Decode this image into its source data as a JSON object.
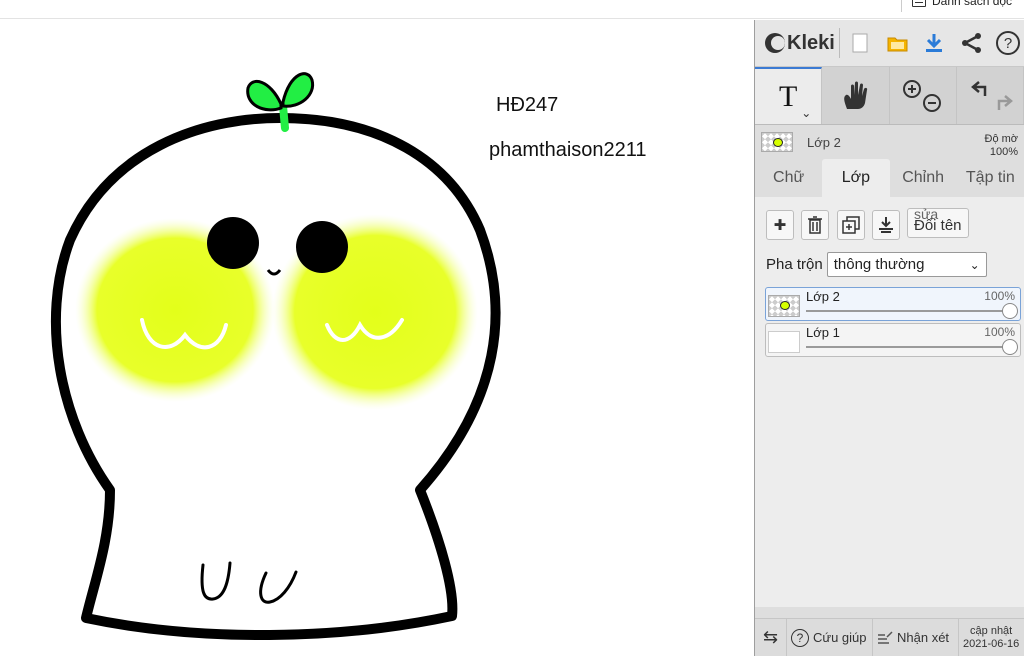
{
  "browser": {
    "reading_list_label": "Danh sách đọc"
  },
  "canvas": {
    "text_line_1": "HĐ247",
    "text_line_2": "phamthaison2211",
    "colors": {
      "outline": "#000000",
      "sprout": "#22ee44",
      "cheek": "#e8ff2a",
      "background": "#ffffff"
    }
  },
  "app": {
    "brand": "Kleki",
    "toolbar_icons": [
      "new-image-icon",
      "open-folder-icon",
      "download-icon",
      "share-icon",
      "help-icon"
    ],
    "tools": [
      {
        "name": "text-tool",
        "glyph": "T",
        "active": true
      },
      {
        "name": "hand-tool",
        "glyph": "✋",
        "active": false
      },
      {
        "name": "zoom-tool",
        "glyph": "⊕⊖",
        "active": false
      },
      {
        "name": "undo-redo",
        "glyph": "↶↷",
        "active": false
      }
    ],
    "current_layer": {
      "name": "Lớp 2",
      "opacity_label": "Độ mờ",
      "opacity_value": "100%"
    },
    "tabs": [
      "Chữ",
      "Lớp",
      "Chỉnh sửa",
      "Tập tin"
    ],
    "tabs_shown": [
      "Chữ",
      "Lớp",
      "Chỉnh",
      "Tập tin"
    ],
    "active_tab": "Lớp",
    "layer_buttons": {
      "add": "✚",
      "delete": "🗑",
      "duplicate": "⧉",
      "merge": "⤓",
      "rename_overlap": "sửa",
      "rename": "Đổi tên"
    },
    "blend": {
      "label": "Pha trộn",
      "value": "thông thường"
    },
    "layers": [
      {
        "name": "Lớp 2",
        "opacity": "100%",
        "active": true
      },
      {
        "name": "Lớp 1",
        "opacity": "100%",
        "active": false
      }
    ],
    "footer": {
      "swap_icon": "⇆",
      "help": "Cứu giúp",
      "feedback": "Nhận xét",
      "update_label": "cập nhật",
      "update_date": "2021-06-16"
    }
  }
}
